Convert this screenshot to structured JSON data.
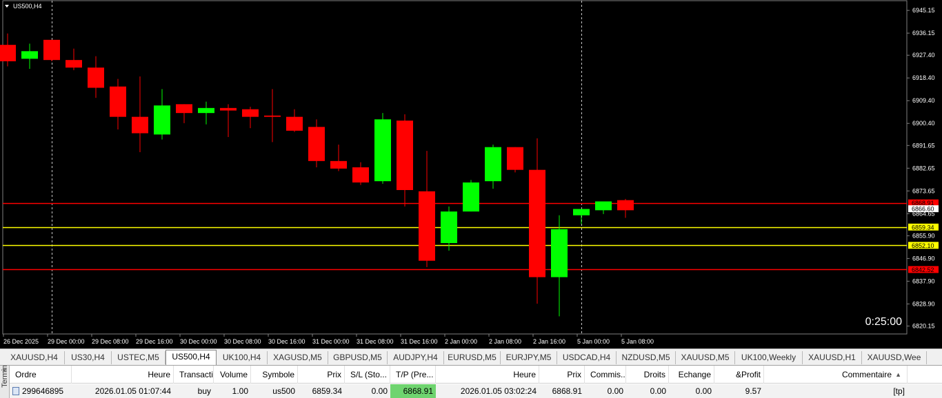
{
  "chart": {
    "symbol_label": "US500,H4",
    "countdown": "0:25:00",
    "colors": {
      "bull": "#00ff00",
      "bear": "#ff0000",
      "background": "#000000",
      "axis_text": "#ffffff",
      "line_red": "#ff0000",
      "line_yellow": "#ffff00"
    },
    "price_range": [
      6817,
      6949
    ],
    "price_ticks": [
      "6945.15",
      "6936.15",
      "6927.40",
      "6918.40",
      "6909.40",
      "6900.40",
      "6891.65",
      "6882.65",
      "6873.65",
      "6864.65",
      "6855.90",
      "6846.90",
      "6837.90",
      "6828.90",
      "6820.15"
    ],
    "time_labels": [
      "26 Dec 2025",
      "29 Dec 00:00",
      "29 Dec 08:00",
      "29 Dec 16:00",
      "30 Dec 00:00",
      "30 Dec 08:00",
      "30 Dec 16:00",
      "31 Dec 00:00",
      "31 Dec 08:00",
      "31 Dec 16:00",
      "2 Jan 00:00",
      "2 Jan 08:00",
      "2 Jan 16:00",
      "5 Jan 00:00",
      "5 Jan 08:00"
    ],
    "period_separators": [
      2,
      26
    ],
    "level_lines": [
      {
        "price": 6868.91,
        "label": "6868.91",
        "color": "#ff0000",
        "tag_bg": "#ff0000",
        "tag_fg": "#000000"
      },
      {
        "price": 6866.6,
        "label": "6866.60",
        "color": "none",
        "tag_bg": "#ffffff",
        "tag_fg": "#000000"
      },
      {
        "price": 6859.34,
        "label": "6859.34",
        "color": "#ffff00",
        "tag_bg": "#ffff00",
        "tag_fg": "#000000"
      },
      {
        "price": 6852.1,
        "label": "6852.10",
        "color": "#ffff00",
        "tag_bg": "#ffff00",
        "tag_fg": "#000000"
      },
      {
        "price": 6842.52,
        "label": "6842.52",
        "color": "#ff0000",
        "tag_bg": "#ff0000",
        "tag_fg": "#000000"
      }
    ],
    "candles": [
      {
        "o": 6931.5,
        "h": 6936.0,
        "l": 6923.0,
        "c": 6925.0
      },
      {
        "o": 6926.0,
        "h": 6932.0,
        "l": 6922.0,
        "c": 6929.0
      },
      {
        "o": 6933.5,
        "h": 6933.5,
        "l": 6925.0,
        "c": 6925.5
      },
      {
        "o": 6925.5,
        "h": 6930.0,
        "l": 6921.5,
        "c": 6922.5
      },
      {
        "o": 6922.5,
        "h": 6927.0,
        "l": 6910.5,
        "c": 6914.5
      },
      {
        "o": 6915.0,
        "h": 6918.0,
        "l": 6898.0,
        "c": 6903.0
      },
      {
        "o": 6903.0,
        "h": 6919.0,
        "l": 6889.0,
        "c": 6896.5
      },
      {
        "o": 6896.0,
        "h": 6914.0,
        "l": 6894.0,
        "c": 6907.5
      },
      {
        "o": 6908.0,
        "h": 6908.0,
        "l": 6900.5,
        "c": 6904.5
      },
      {
        "o": 6904.5,
        "h": 6909.0,
        "l": 6900.0,
        "c": 6906.5
      },
      {
        "o": 6906.5,
        "h": 6908.0,
        "l": 6895.0,
        "c": 6905.5
      },
      {
        "o": 6906.0,
        "h": 6907.0,
        "l": 6898.5,
        "c": 6903.0
      },
      {
        "o": 6903.5,
        "h": 6914.0,
        "l": 6893.0,
        "c": 6903.0
      },
      {
        "o": 6903.0,
        "h": 6906.0,
        "l": 6897.0,
        "c": 6897.5
      },
      {
        "o": 6899.0,
        "h": 6902.0,
        "l": 6883.0,
        "c": 6885.5
      },
      {
        "o": 6885.5,
        "h": 6892.0,
        "l": 6881.5,
        "c": 6882.5
      },
      {
        "o": 6883.0,
        "h": 6885.0,
        "l": 6876.0,
        "c": 6877.0
      },
      {
        "o": 6877.5,
        "h": 6904.5,
        "l": 6876.5,
        "c": 6902.0
      },
      {
        "o": 6901.5,
        "h": 6904.0,
        "l": 6867.5,
        "c": 6874.0
      },
      {
        "o": 6873.5,
        "h": 6889.5,
        "l": 6843.5,
        "c": 6846.0
      },
      {
        "o": 6853.0,
        "h": 6867.5,
        "l": 6850.0,
        "c": 6865.5
      },
      {
        "o": 6865.5,
        "h": 6878.0,
        "l": 6865.5,
        "c": 6877.0
      },
      {
        "o": 6877.5,
        "h": 6892.0,
        "l": 6874.5,
        "c": 6891.0
      },
      {
        "o": 6891.0,
        "h": 6891.0,
        "l": 6881.0,
        "c": 6882.0
      },
      {
        "o": 6882.0,
        "h": 6894.5,
        "l": 6829.0,
        "c": 6839.5
      },
      {
        "o": 6839.5,
        "h": 6864.0,
        "l": 6824.0,
        "c": 6858.5
      },
      {
        "o": 6864.0,
        "h": 6866.5,
        "l": 6860.5,
        "c": 6866.5
      },
      {
        "o": 6866.0,
        "h": 6869.5,
        "l": 6864.5,
        "c": 6869.5
      },
      {
        "o": 6870.0,
        "h": 6870.5,
        "l": 6863.0,
        "c": 6866.0
      }
    ]
  },
  "tabs": [
    {
      "label": "XAUUSD,H4"
    },
    {
      "label": "US30,H4"
    },
    {
      "label": "USTEC,M5"
    },
    {
      "label": "US500,H4",
      "active": true
    },
    {
      "label": "UK100,H4"
    },
    {
      "label": "XAGUSD,M5"
    },
    {
      "label": "GBPUSD,M5"
    },
    {
      "label": "AUDJPY,H4"
    },
    {
      "label": "EURUSD,M5"
    },
    {
      "label": "EURJPY,M5"
    },
    {
      "label": "USDCAD,H4"
    },
    {
      "label": "NZDUSD,M5"
    },
    {
      "label": "XAUUSD,M5"
    },
    {
      "label": "UK100,Weekly"
    },
    {
      "label": "XAUUSD,H1"
    },
    {
      "label": "XAUUSD,Wee"
    }
  ],
  "terminal": {
    "side_label": "Terminal",
    "close_glyph": "×",
    "columns": [
      {
        "label": "Ordre",
        "align": "l"
      },
      {
        "label": "Heure",
        "align": "r"
      },
      {
        "label": "Transacti...",
        "align": "l"
      },
      {
        "label": "Volume",
        "align": "r"
      },
      {
        "label": "Symbole",
        "align": "r"
      },
      {
        "label": "Prix",
        "align": "r"
      },
      {
        "label": "S/L (Sto...",
        "align": "l"
      },
      {
        "label": "T/P (Pre...",
        "align": "l"
      },
      {
        "label": "Heure",
        "align": "r"
      },
      {
        "label": "Prix",
        "align": "r"
      },
      {
        "label": "Commis...",
        "align": "l"
      },
      {
        "label": "Droits",
        "align": "r"
      },
      {
        "label": "Echange",
        "align": "r"
      },
      {
        "label": "&Profit",
        "align": "r"
      },
      {
        "label": "Commentaire",
        "align": "r"
      }
    ],
    "sort_glyph": "▲",
    "rows": [
      [
        "299646895",
        "2026.01.05 01:07:44",
        "buy",
        "1.00",
        "us500",
        "6859.34",
        "0.00",
        "6868.91",
        "2026.01.05 03:02:24",
        "6868.91",
        "0.00",
        "0.00",
        "0.00",
        "9.57",
        "[tp]"
      ]
    ],
    "tp_highlight_color": "#6fd46f"
  }
}
